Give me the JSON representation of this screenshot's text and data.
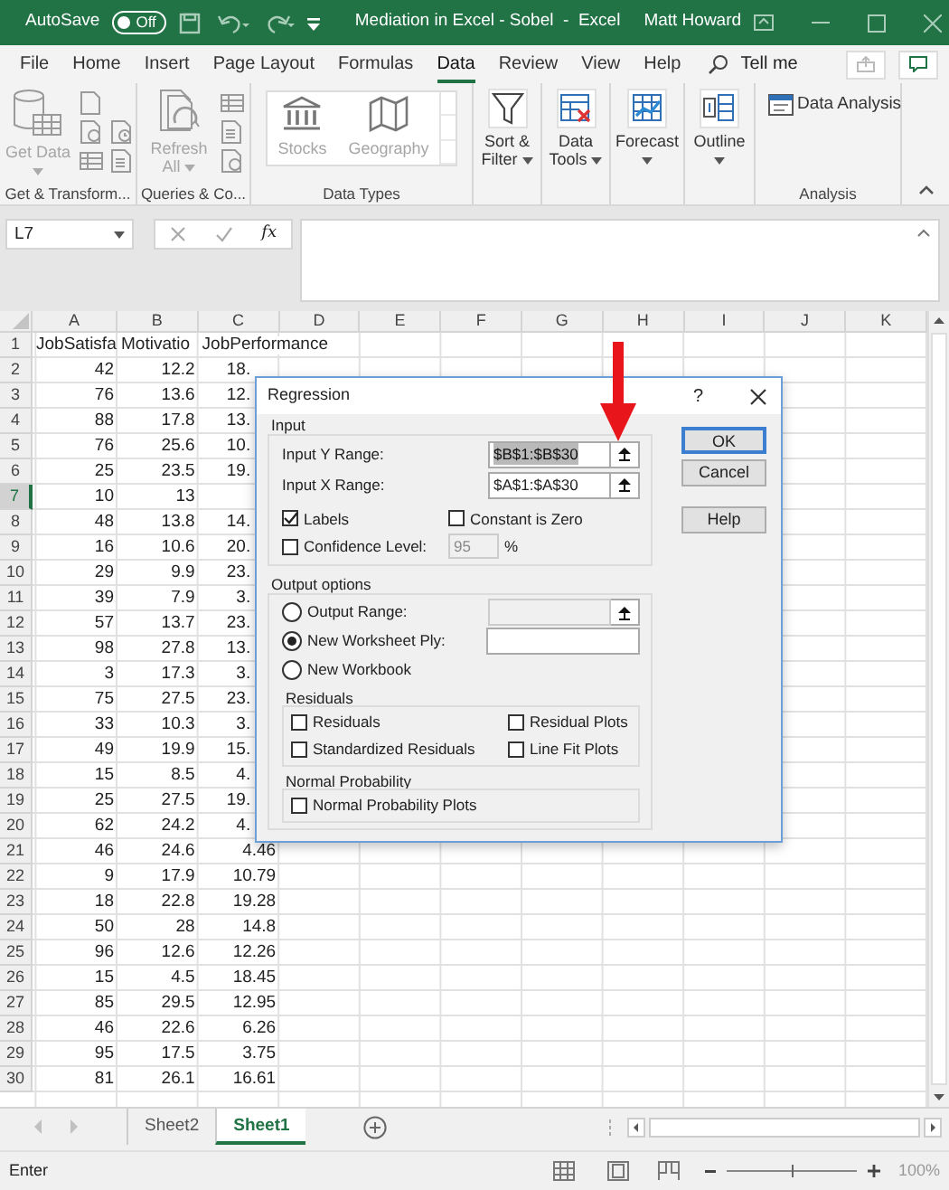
{
  "title_bar": {
    "autosave_label": "AutoSave",
    "autosave_toggle": {
      "label": "Off",
      "on": false
    },
    "document_title": "Mediation in Excel - Sobel  -  Excel",
    "user": "Matt Howard"
  },
  "menu_tabs": [
    {
      "label": "File",
      "selected": false
    },
    {
      "label": "Home",
      "selected": false
    },
    {
      "label": "Insert",
      "selected": false
    },
    {
      "label": "Page Layout",
      "selected": false
    },
    {
      "label": "Formulas",
      "selected": false
    },
    {
      "label": "Data",
      "selected": true
    },
    {
      "label": "Review",
      "selected": false
    },
    {
      "label": "View",
      "selected": false
    },
    {
      "label": "Help",
      "selected": false
    }
  ],
  "tell_me": "Tell me",
  "ribbon": {
    "groups": [
      {
        "label": "Get & Transform...",
        "commands": [
          {
            "kind": "database",
            "label": "Get Data",
            "menu": true,
            "disabled": true
          },
          {
            "kind": "small",
            "disabled": true
          },
          {
            "kind": "small",
            "disabled": true
          },
          {
            "kind": "small",
            "disabled": true
          },
          {
            "kind": "small",
            "disabled": true
          },
          {
            "kind": "small",
            "disabled": true
          }
        ]
      },
      {
        "label": "Queries & Co...",
        "commands": [
          {
            "kind": "refresh",
            "label": "Refresh All",
            "menu": true,
            "disabled": true
          },
          {
            "kind": "small",
            "disabled": true
          },
          {
            "kind": "small",
            "disabled": true
          },
          {
            "kind": "small",
            "disabled": true
          }
        ]
      },
      {
        "label": "Data Types",
        "commands": [
          {
            "kind": "gallery",
            "items": [
              {
                "label": "Stocks",
                "disabled": true
              },
              {
                "label": "Geography",
                "disabled": true
              }
            ]
          }
        ]
      },
      {
        "commands": [
          {
            "kind": "filter",
            "label": "Sort & Filter",
            "menu": true,
            "disabled": false
          }
        ]
      },
      {
        "commands": [
          {
            "kind": "tools",
            "label": "Data Tools",
            "menu": true,
            "disabled": false
          }
        ]
      },
      {
        "commands": [
          {
            "kind": "forecast",
            "label": "Forecast",
            "menu": true,
            "disabled": false
          }
        ]
      },
      {
        "commands": [
          {
            "kind": "outline",
            "label": "Outline",
            "menu": true,
            "disabled": false
          }
        ]
      },
      {
        "label": "Analysis",
        "commands": [
          {
            "kind": "analysis",
            "label": "Data Analysis",
            "disabled": false
          }
        ]
      }
    ]
  },
  "formula_bar": {
    "name_box": "L7",
    "function_label": "fx"
  },
  "sheet": {
    "columns": [
      "A",
      "B",
      "C",
      "D",
      "E",
      "F",
      "G",
      "H",
      "I",
      "J",
      "K"
    ],
    "rows": [
      {
        "number": "1",
        "kind": "header",
        "selected": false,
        "cells": [
          "JobSatisfa",
          "Motivatio",
          "JobPerformance"
        ]
      },
      {
        "number": "2",
        "kind": "data",
        "selected": false,
        "cells": [
          "42",
          "12.2",
          "18."
        ]
      },
      {
        "number": "3",
        "kind": "data",
        "selected": false,
        "cells": [
          "76",
          "13.6",
          "12."
        ]
      },
      {
        "number": "4",
        "kind": "data",
        "selected": false,
        "cells": [
          "88",
          "17.8",
          "13."
        ]
      },
      {
        "number": "5",
        "kind": "data",
        "selected": false,
        "cells": [
          "76",
          "25.6",
          "10."
        ]
      },
      {
        "number": "6",
        "kind": "data",
        "selected": false,
        "cells": [
          "25",
          "23.5",
          "19."
        ]
      },
      {
        "number": "7",
        "kind": "data",
        "selected": true,
        "cells": [
          "10",
          "13"
        ]
      },
      {
        "number": "8",
        "kind": "data",
        "selected": false,
        "cells": [
          "48",
          "13.8",
          "14."
        ]
      },
      {
        "number": "9",
        "kind": "data",
        "selected": false,
        "cells": [
          "16",
          "10.6",
          "20."
        ]
      },
      {
        "number": "10",
        "kind": "data",
        "selected": false,
        "cells": [
          "29",
          "9.9",
          "23."
        ]
      },
      {
        "number": "11",
        "kind": "data",
        "selected": false,
        "cells": [
          "39",
          "7.9",
          "3."
        ]
      },
      {
        "number": "12",
        "kind": "data",
        "selected": false,
        "cells": [
          "57",
          "13.7",
          "23."
        ]
      },
      {
        "number": "13",
        "kind": "data",
        "selected": false,
        "cells": [
          "98",
          "27.8",
          "13."
        ]
      },
      {
        "number": "14",
        "kind": "data",
        "selected": false,
        "cells": [
          "3",
          "17.3",
          "3."
        ]
      },
      {
        "number": "15",
        "kind": "data",
        "selected": false,
        "cells": [
          "75",
          "27.5",
          "23."
        ]
      },
      {
        "number": "16",
        "kind": "data",
        "selected": false,
        "cells": [
          "33",
          "10.3",
          "3."
        ]
      },
      {
        "number": "17",
        "kind": "data",
        "selected": false,
        "cells": [
          "49",
          "19.9",
          "15."
        ]
      },
      {
        "number": "18",
        "kind": "data",
        "selected": false,
        "cells": [
          "15",
          "8.5",
          "4."
        ]
      },
      {
        "number": "19",
        "kind": "data",
        "selected": false,
        "cells": [
          "25",
          "27.5",
          "19."
        ]
      },
      {
        "number": "20",
        "kind": "data",
        "selected": false,
        "cells": [
          "62",
          "24.2",
          "4."
        ]
      },
      {
        "number": "21",
        "kind": "data",
        "selected": false,
        "cells": [
          "46",
          "24.6",
          "4.46"
        ]
      },
      {
        "number": "22",
        "kind": "data",
        "selected": false,
        "cells": [
          "9",
          "17.9",
          "10.79"
        ]
      },
      {
        "number": "23",
        "kind": "data",
        "selected": false,
        "cells": [
          "18",
          "22.8",
          "19.28"
        ]
      },
      {
        "number": "24",
        "kind": "data",
        "selected": false,
        "cells": [
          "50",
          "28",
          "14.8"
        ]
      },
      {
        "number": "25",
        "kind": "data",
        "selected": false,
        "cells": [
          "96",
          "12.6",
          "12.26"
        ]
      },
      {
        "number": "26",
        "kind": "data",
        "selected": false,
        "cells": [
          "15",
          "4.5",
          "18.45"
        ]
      },
      {
        "number": "27",
        "kind": "data",
        "selected": false,
        "cells": [
          "85",
          "29.5",
          "12.95"
        ]
      },
      {
        "number": "28",
        "kind": "data",
        "selected": false,
        "cells": [
          "46",
          "22.6",
          "6.26"
        ]
      },
      {
        "number": "29",
        "kind": "data",
        "selected": false,
        "cells": [
          "95",
          "17.5",
          "3.75"
        ]
      },
      {
        "number": "30",
        "kind": "data",
        "selected": false,
        "cells": [
          "81",
          "26.1",
          "16.61"
        ]
      }
    ]
  },
  "dialog": {
    "title": "Regression",
    "help": "?",
    "input": {
      "legend": "Input",
      "ranges": [
        {
          "label": "Input Y Range:",
          "value": "$B$1:$B$30",
          "selected": true
        },
        {
          "label": "Input X Range:",
          "value": "$A$1:$A$30",
          "selected": false
        }
      ],
      "options": [
        {
          "label": "Labels",
          "checked": true
        },
        {
          "label": "Constant is Zero",
          "checked": false
        },
        {
          "label": "Confidence Level:",
          "checked": false
        }
      ],
      "confidence": {
        "value": "95",
        "disabled": true,
        "unit": "%"
      }
    },
    "output": {
      "legend": "Output options",
      "choices": [
        {
          "label": "Output Range:",
          "selected": false,
          "kind": "range",
          "disabled": true
        },
        {
          "label": "New Worksheet Ply:",
          "selected": true,
          "kind": "field",
          "disabled": false
        },
        {
          "label": "New Workbook",
          "selected": false,
          "kind": "plain"
        }
      ],
      "residuals": {
        "legend": "Residuals",
        "options": [
          {
            "label": "Residuals",
            "checked": false
          },
          {
            "label": "Residual Plots",
            "checked": false
          },
          {
            "label": "Standardized Residuals",
            "checked": false
          },
          {
            "label": "Line Fit Plots",
            "checked": false
          }
        ]
      },
      "normal": {
        "legend": "Normal Probability",
        "options": [
          {
            "label": "Normal Probability Plots",
            "checked": false
          }
        ]
      }
    },
    "buttons": [
      {
        "label": "OK",
        "default": true
      },
      {
        "label": "Cancel",
        "default": false
      },
      {
        "label": "Help",
        "default": false
      }
    ]
  },
  "sheet_tabs": [
    {
      "label": "Sheet2",
      "selected": false
    },
    {
      "label": "Sheet1",
      "selected": true
    }
  ],
  "status_bar": {
    "mode": "Enter",
    "zoom": {
      "level": 0.5,
      "label": "100%"
    }
  }
}
